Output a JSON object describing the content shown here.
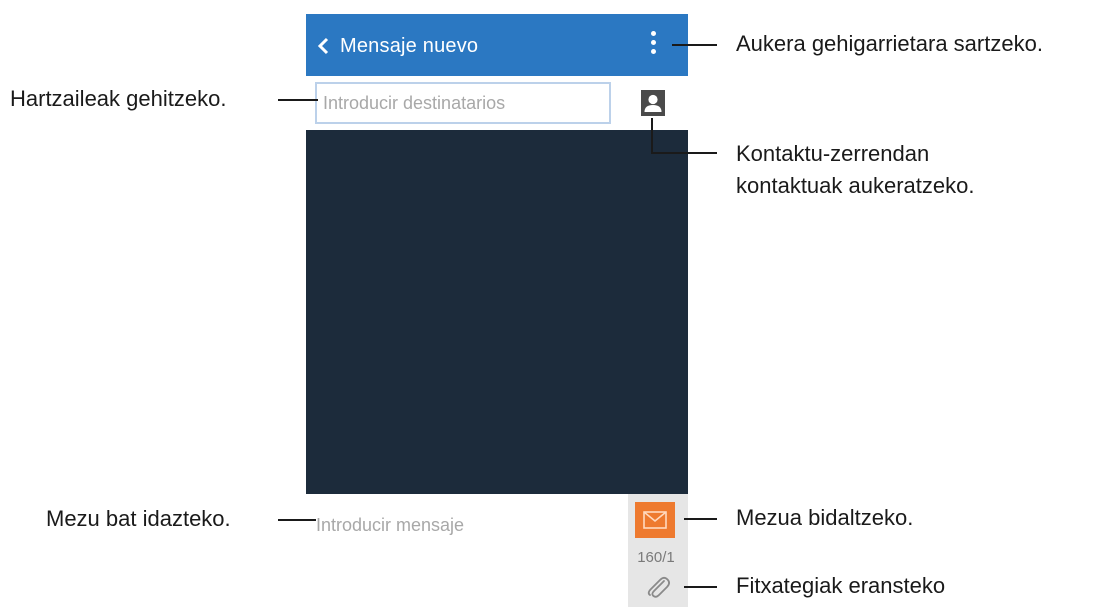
{
  "app": {
    "title": "Mensaje nuevo",
    "recipient_placeholder": "Introducir destinatarios",
    "message_placeholder": "Introducir mensaje",
    "char_counter": "160/1"
  },
  "colors": {
    "appbar": "#2b78c2",
    "conversation_bg": "#1c2b3b",
    "send_button": "#ee7a2f",
    "side_panel": "#e6e6e6"
  },
  "icons": {
    "back": "chevron-left-icon",
    "menu": "more-vertical-icon",
    "contacts": "contact-card-icon",
    "send": "envelope-send-icon",
    "attach": "paperclip-icon"
  },
  "annotations": {
    "more_options": "Aukera gehigarrietara sartzeko.",
    "add_recipients": "Hartzaileak gehitzeko.",
    "contacts_line1": "Kontaktu-zerrendan",
    "contacts_line2": "kontaktuak aukeratzeko.",
    "compose": "Mezu bat idazteko.",
    "send": "Mezua bidaltzeko.",
    "attach": "Fitxategiak eransteko"
  }
}
